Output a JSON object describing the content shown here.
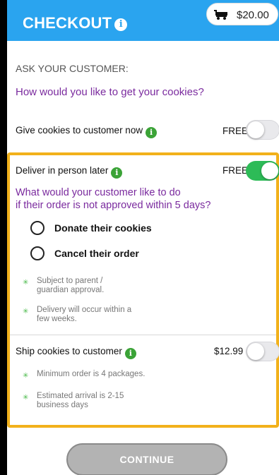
{
  "header": {
    "title": "CHECKOUT",
    "info_glyph": "i",
    "cart_total": "$20.00",
    "cart_icon": "cart-icon"
  },
  "ask_label": "ASK YOUR CUSTOMER:",
  "question": "How would you like to get your cookies?",
  "options": [
    {
      "label": "Give cookies to customer now",
      "price": "FREE",
      "enabled": false
    },
    {
      "label": "Deliver in person later",
      "price": "FREE",
      "enabled": true
    },
    {
      "label": "Ship cookies to customer",
      "price": "$12.99",
      "enabled": false
    }
  ],
  "deliver_later": {
    "question_line1": "What would your customer like to do",
    "question_line2": "if their order is not approved within 5 days?",
    "choices": [
      "Donate their cookies",
      "Cancel their order"
    ],
    "notes": [
      {
        "line1": "Subject to parent /",
        "line2": "guardian approval."
      },
      {
        "line1": "Delivery will occur within a",
        "line2": "few weeks."
      }
    ]
  },
  "ship": {
    "notes": [
      {
        "line1": "Minimum order is 4 packages.",
        "line2": ""
      },
      {
        "line1": "Estimated arrival is 2-15",
        "line2": "business days"
      }
    ]
  },
  "continue_label": "CONTINUE",
  "colors": {
    "header": "#2aa4ef",
    "accent_purple": "#7a2a9e",
    "toggle_on": "#2dbb57",
    "highlight": "#f2b11b"
  }
}
